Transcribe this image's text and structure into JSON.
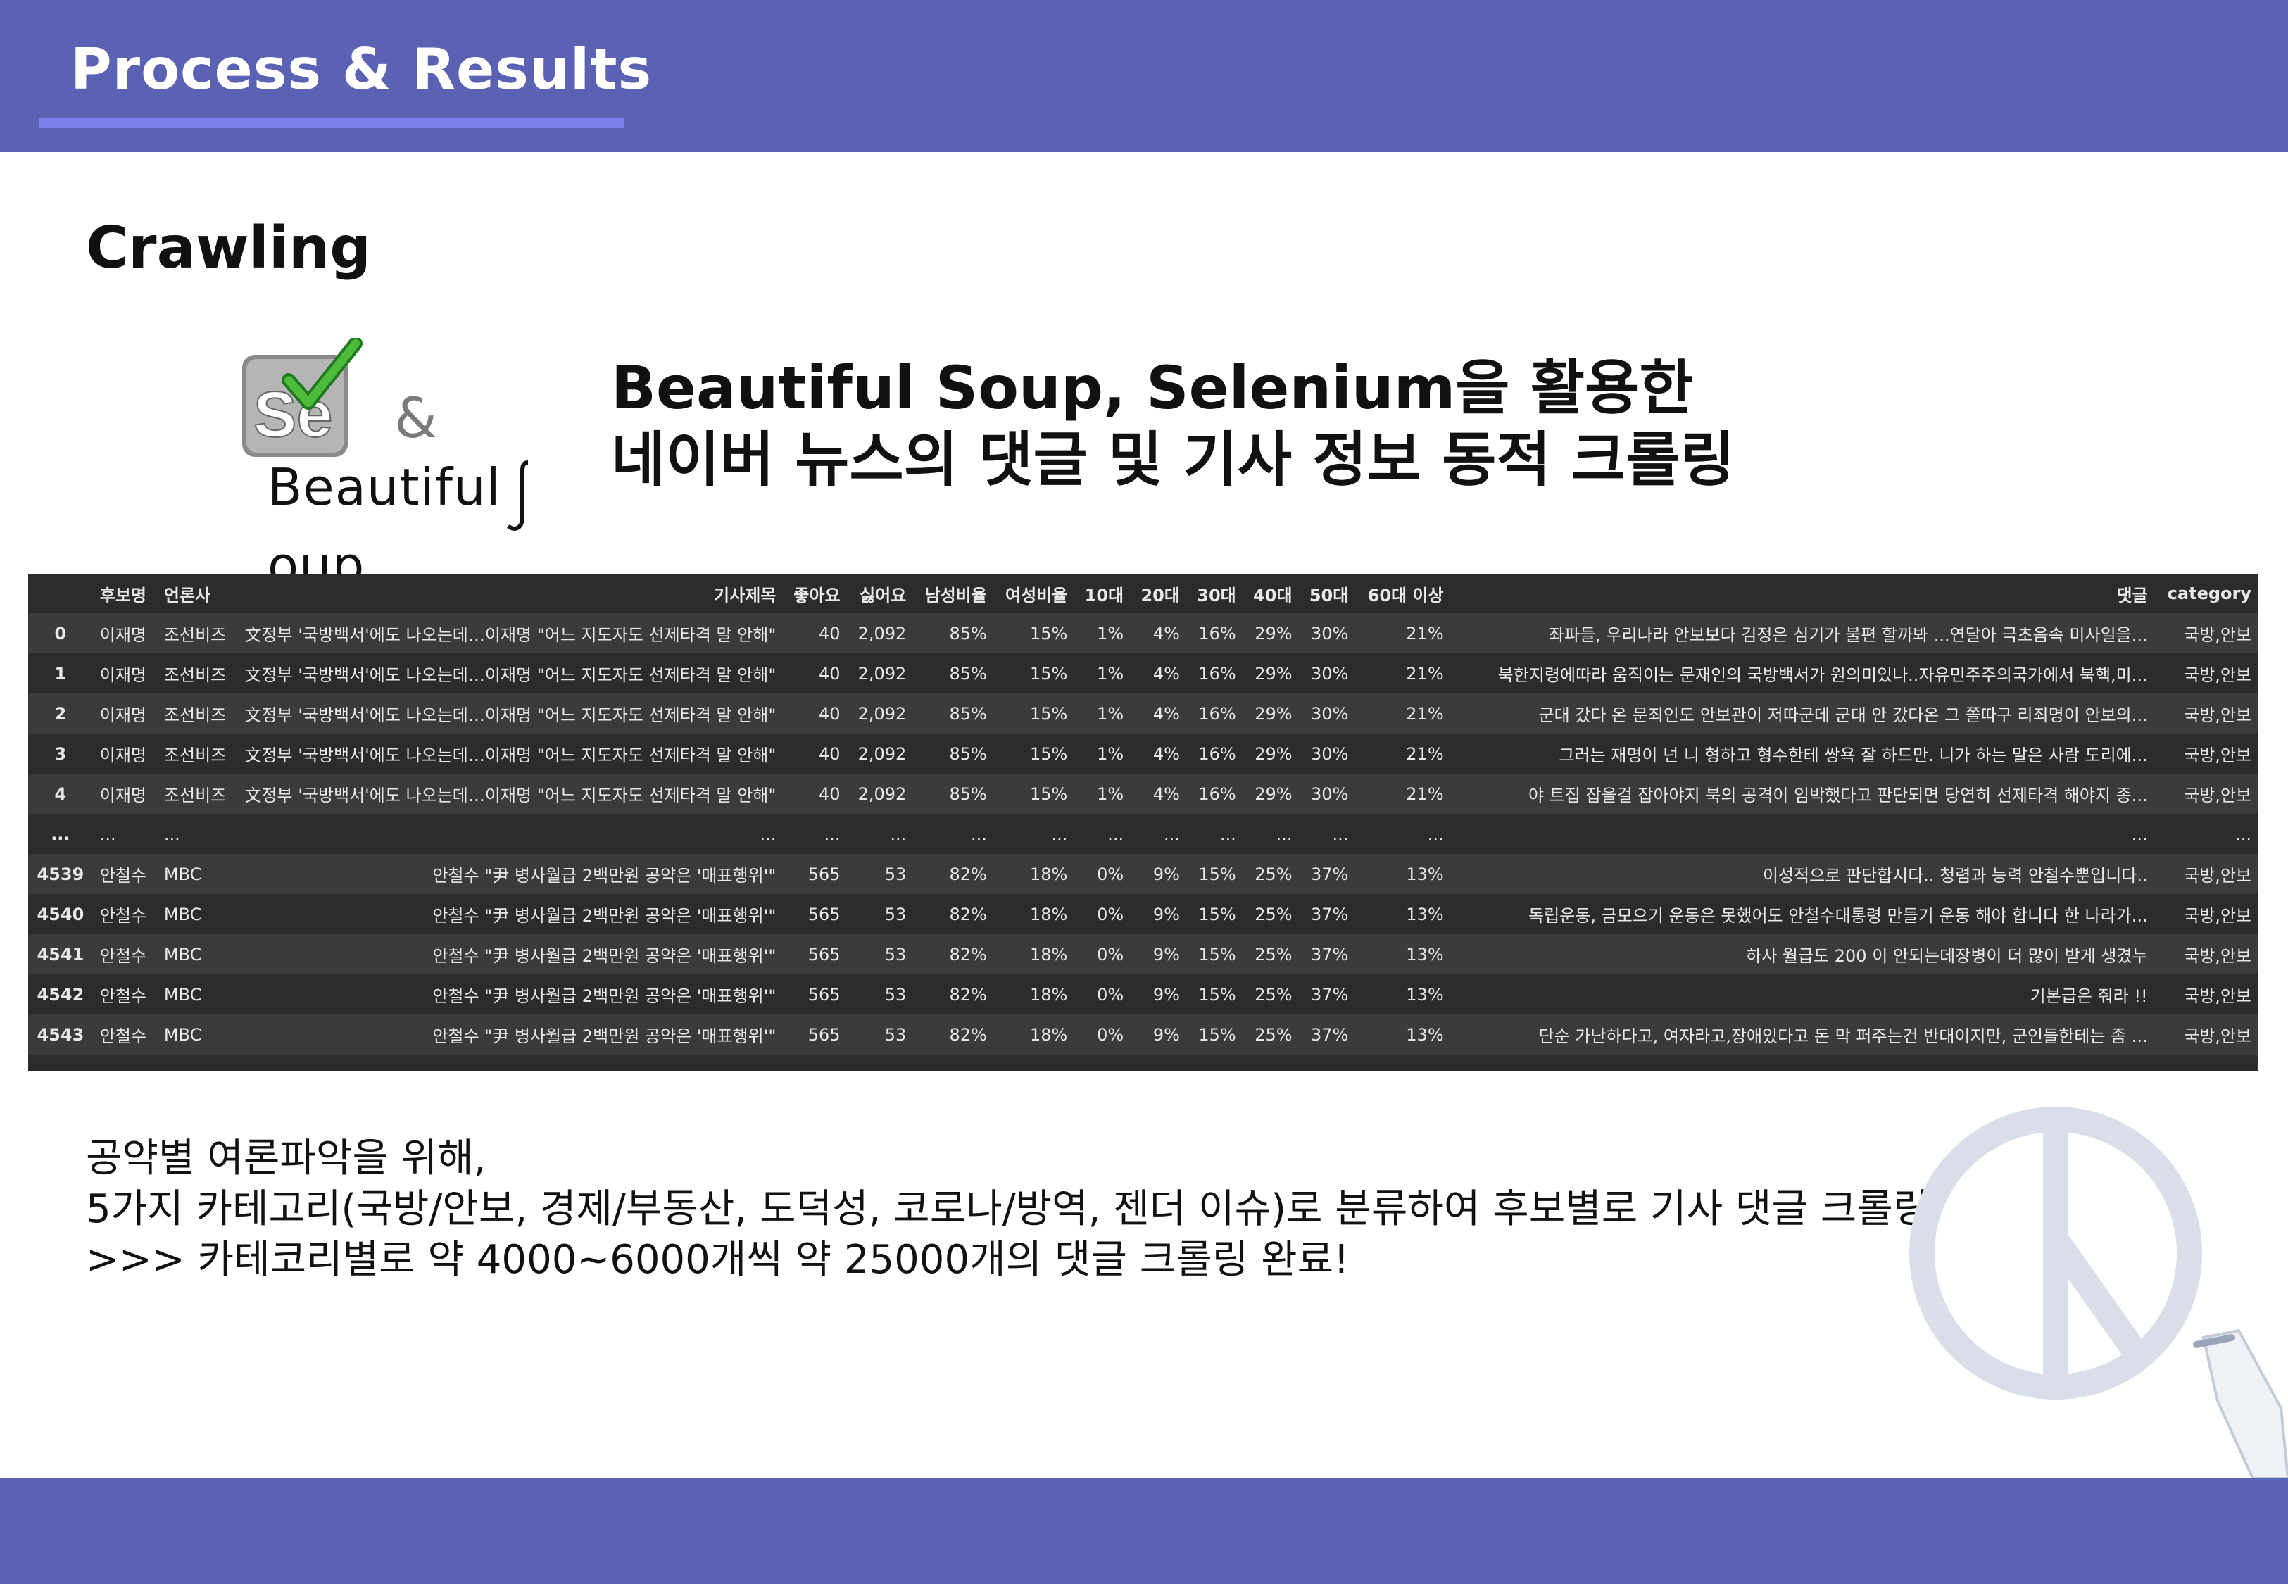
{
  "header": {
    "title": "Process & Results"
  },
  "section": {
    "title": "Crawling"
  },
  "logos": {
    "ampersand": "&",
    "bs_text_left": "Beautiful",
    "bs_text_right": "oup",
    "se_text": "Se"
  },
  "heading": {
    "line1": "Beautiful Soup, Selenium을 활용한",
    "line2": "네이버 뉴스의 댓글 및 기사 정보 동적 크롤링"
  },
  "table": {
    "columns": [
      "",
      "후보명",
      "언론사",
      "기사제목",
      "좋아요",
      "싫어요",
      "남성비율",
      "여성비율",
      "10대",
      "20대",
      "30대",
      "40대",
      "50대",
      "60대 이상",
      "댓글",
      "category"
    ],
    "rows": [
      [
        "0",
        "이재명",
        "조선비즈",
        "文정부 '국방백서'에도 나오는데…이재명 \"어느 지도자도 선제타격 말 안해\"",
        "40",
        "2,092",
        "85%",
        "15%",
        "1%",
        "4%",
        "16%",
        "29%",
        "30%",
        "21%",
        "좌파들, 우리나라 안보보다 김정은 심기가 불편 할까봐 ...연달아 극초음속 미사일을...",
        "국방,안보"
      ],
      [
        "1",
        "이재명",
        "조선비즈",
        "文정부 '국방백서'에도 나오는데…이재명 \"어느 지도자도 선제타격 말 안해\"",
        "40",
        "2,092",
        "85%",
        "15%",
        "1%",
        "4%",
        "16%",
        "29%",
        "30%",
        "21%",
        "북한지령에따라 움직이는 문재인의 국방백서가 원의미있나..자유민주주의국가에서 북핵,미...",
        "국방,안보"
      ],
      [
        "2",
        "이재명",
        "조선비즈",
        "文정부 '국방백서'에도 나오는데…이재명 \"어느 지도자도 선제타격 말 안해\"",
        "40",
        "2,092",
        "85%",
        "15%",
        "1%",
        "4%",
        "16%",
        "29%",
        "30%",
        "21%",
        "군대 갔다 온 문죄인도 안보관이 저따군데 군대 안 갔다온 그 쫄따구 리죄명이 안보의...",
        "국방,안보"
      ],
      [
        "3",
        "이재명",
        "조선비즈",
        "文정부 '국방백서'에도 나오는데…이재명 \"어느 지도자도 선제타격 말 안해\"",
        "40",
        "2,092",
        "85%",
        "15%",
        "1%",
        "4%",
        "16%",
        "29%",
        "30%",
        "21%",
        "그러는 재명이 넌 니 형하고 형수한테 쌍욕 잘 하드만. 니가 하는 말은 사람 도리에...",
        "국방,안보"
      ],
      [
        "4",
        "이재명",
        "조선비즈",
        "文정부 '국방백서'에도 나오는데…이재명 \"어느 지도자도 선제타격 말 안해\"",
        "40",
        "2,092",
        "85%",
        "15%",
        "1%",
        "4%",
        "16%",
        "29%",
        "30%",
        "21%",
        "야 트집 잡을걸 잡아야지 북의 공격이 임박했다고 판단되면 당연히 선제타격 해야지 종...",
        "국방,안보"
      ],
      [
        "...",
        "...",
        "...",
        "...",
        "...",
        "...",
        "...",
        "...",
        "...",
        "...",
        "...",
        "...",
        "...",
        "...",
        "...",
        "..."
      ],
      [
        "4539",
        "안철수",
        "MBC",
        "안철수 \"尹 병사월급 2백만원 공약은 '매표행위'\"",
        "565",
        "53",
        "82%",
        "18%",
        "0%",
        "9%",
        "15%",
        "25%",
        "37%",
        "13%",
        "이성적으로 판단합시다.. 청렴과 능력 안철수뿐입니다..",
        "국방,안보"
      ],
      [
        "4540",
        "안철수",
        "MBC",
        "안철수 \"尹 병사월급 2백만원 공약은 '매표행위'\"",
        "565",
        "53",
        "82%",
        "18%",
        "0%",
        "9%",
        "15%",
        "25%",
        "37%",
        "13%",
        "독립운동, 금모으기 운동은 못했어도 안철수대통령 만들기 운동 해야 합니다 한 나라가...",
        "국방,안보"
      ],
      [
        "4541",
        "안철수",
        "MBC",
        "안철수 \"尹 병사월급 2백만원 공약은 '매표행위'\"",
        "565",
        "53",
        "82%",
        "18%",
        "0%",
        "9%",
        "15%",
        "25%",
        "37%",
        "13%",
        "하사 월급도 200 이 안되는데장병이 더 많이 받게 생겼누",
        "국방,안보"
      ],
      [
        "4542",
        "안철수",
        "MBC",
        "안철수 \"尹 병사월급 2백만원 공약은 '매표행위'\"",
        "565",
        "53",
        "82%",
        "18%",
        "0%",
        "9%",
        "15%",
        "25%",
        "37%",
        "13%",
        "기본급은 줘라 !!",
        "국방,안보"
      ],
      [
        "4543",
        "안철수",
        "MBC",
        "안철수 \"尹 병사월급 2백만원 공약은 '매표행위'\"",
        "565",
        "53",
        "82%",
        "18%",
        "0%",
        "9%",
        "15%",
        "25%",
        "37%",
        "13%",
        "단순 가난하다고, 여자라고,장애있다고 돈 막 퍼주는건 반대이지만, 군인들한테는 좀 ...",
        "국방,안보"
      ]
    ]
  },
  "body": {
    "line1": "공약별 여론파악을 위해,",
    "line2": "5가지 카테고리(국방/안보, 경제/부동산, 도덕성, 코로나/방역, 젠더 이슈)로 분류하여 후보별로 기사 댓글 크롤링",
    "line3": ">>> 카테코리별로 약 4000~6000개씩 약 25000개의 댓글 크롤링 완료!"
  },
  "colors": {
    "header_bg": "#5b61b3",
    "underline": "#7b82ee",
    "table_bg": "#2c2c2c",
    "peace_symbol": "#d9dee8"
  }
}
